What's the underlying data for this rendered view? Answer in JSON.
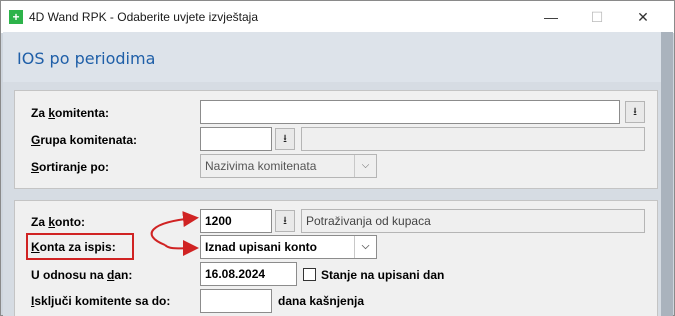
{
  "window": {
    "title": "4D Wand RPK - Odaberite uvjete izvještaja",
    "icon": "app-plus-icon",
    "controls": {
      "minimize": "—",
      "maximize": "☐",
      "close": "✕"
    }
  },
  "page": {
    "title": "IOS po periodima"
  },
  "filters": {
    "komitent": {
      "label_pre": "Za ",
      "label_ul": "k",
      "label_post": "omitenta:",
      "value": ""
    },
    "grupa": {
      "label_pre": "",
      "label_ul": "G",
      "label_post": "rupa komitenata:",
      "value": "",
      "description": ""
    },
    "sortiranje": {
      "label_pre": "",
      "label_ul": "S",
      "label_post": "ortiranje po:",
      "value": "Nazivima komitenata"
    }
  },
  "konto": {
    "za_konto": {
      "label_pre": "Za ",
      "label_ul": "k",
      "label_post": "onto:",
      "value": "1200",
      "description": "Potraživanja od kupaca"
    },
    "konta_za_ispis": {
      "label_pre": "",
      "label_ul": "K",
      "label_post": "onta za ispis:",
      "value": "Iznad upisani konto"
    },
    "u_odnosu": {
      "label_pre": "U odnosu na ",
      "label_ul": "d",
      "label_post": "an:",
      "value": "16.08.2024",
      "checkbox_label": "Stanje na upisani dan",
      "checked": false
    },
    "iskljuci": {
      "label_pre": "",
      "label_ul": "I",
      "label_post": "sključi komitente sa do:",
      "value": "",
      "suffix": "dana kašnjenja"
    }
  },
  "lookup_glyph": "⭳",
  "dropdown_glyph": "⌵",
  "annotation_color": "#d02323"
}
